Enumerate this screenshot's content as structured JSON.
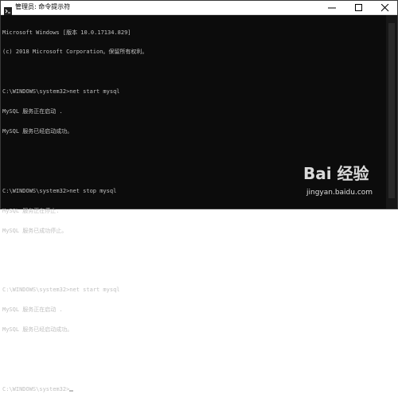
{
  "window": {
    "title": "管理员: 命令提示符"
  },
  "console": {
    "lines": [
      "Microsoft Windows [版本 10.0.17134.829]",
      "(c) 2018 Microsoft Corporation。保留所有权利。",
      "",
      "C:\\WINDOWS\\system32>net start mysql",
      "MySQL 服务正在启动 .",
      "MySQL 服务已经启动成功。",
      "",
      "",
      "C:\\WINDOWS\\system32>net stop mysql",
      "MySQL 服务正在停止.",
      "MySQL 服务已成功停止。",
      "",
      "",
      "C:\\WINDOWS\\system32>net start mysql",
      "MySQL 服务正在启动 .",
      "MySQL 服务已经启动成功。",
      "",
      "",
      "C:\\WINDOWS\\system32>"
    ]
  },
  "watermark": {
    "logo": "Bai 经验",
    "url": "jingyan.baidu.com"
  },
  "icons": {
    "app": "terminal-icon",
    "minimize": "minimize-icon",
    "maximize": "maximize-icon",
    "close": "close-icon"
  }
}
